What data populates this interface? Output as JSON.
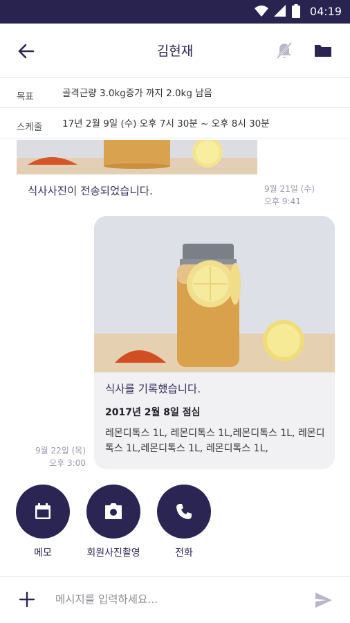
{
  "status": {
    "time": "04:19"
  },
  "header": {
    "title": "김현재"
  },
  "info": {
    "goal_label": "목표",
    "goal_value": "골격근량 3.0kg증가 까지 2.0kg 남음",
    "schedule_label": "스케줄",
    "schedule_value": "17년 2월 9일 (수) 오후 7시 30분 ~ 오후 8시 30분"
  },
  "messages": {
    "m1": {
      "text": "식사사진이 전송되었습니다.",
      "date": "9월 21일 (수)",
      "time": "오후 9:41"
    },
    "m2": {
      "title": "식사를 기록했습니다.",
      "meal": "2017년 2월 8일 점심",
      "detail": "레몬디톡스 1L, 레몬디톡스 1L,레몬디톡스 1L, 레몬디톡스 1L,레몬디톡스 1L, 레몬디톡스 1L,",
      "date": "9월 22일 (목)",
      "time": "오후 3:00"
    }
  },
  "actions": [
    {
      "label": "메모",
      "icon": "calendar-icon"
    },
    {
      "label": "회원사진촬영",
      "icon": "camera-icon"
    },
    {
      "label": "전화",
      "icon": "phone-icon"
    }
  ],
  "composer": {
    "placeholder": "메시지를 입력하세요..."
  },
  "colors": {
    "primary": "#28234f",
    "bubble": "#f1f1f4",
    "muted": "#9a98ad"
  }
}
